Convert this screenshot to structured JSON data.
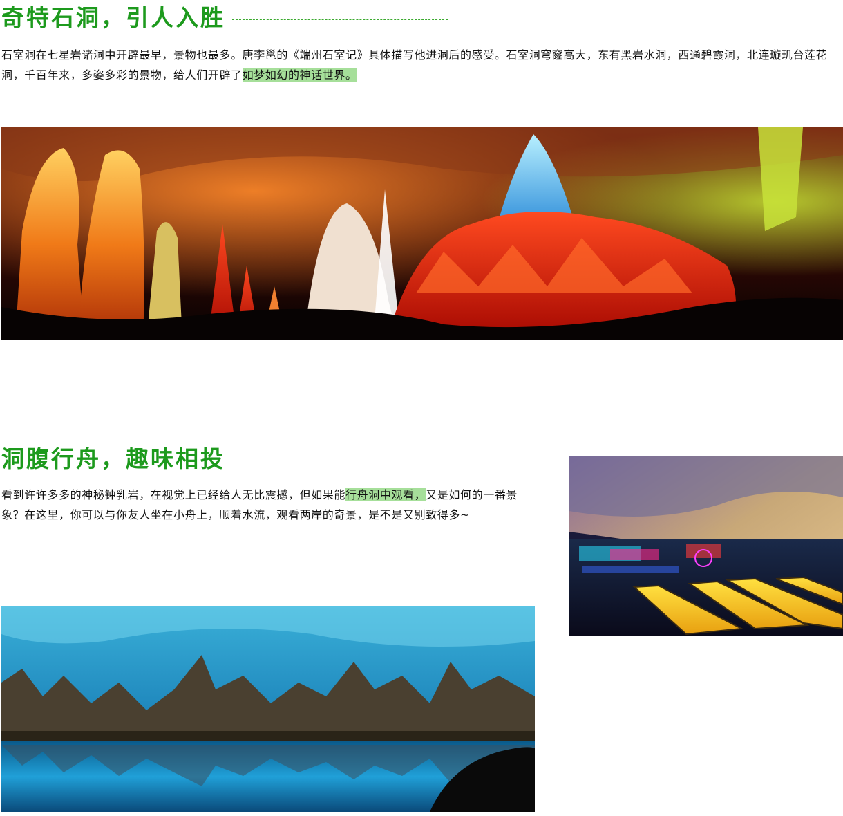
{
  "accent_color": "#1d9a1d",
  "highlight_color": "#a6df9a",
  "section1": {
    "title": "奇特石洞，引人入胜",
    "text_before": "石室洞在七星岩诸洞中开辟最早，景物也最多。唐李邕的《端州石室记》具体描写他进洞后的感受。石室洞穹窿高大，东有黑岩水洞，西通碧霞洞，北连璇玑台莲花洞，千百年来，多姿多彩的景物，给人们开辟了",
    "highlight": "如梦如幻的神话世界。",
    "image": "cave-panorama-photo"
  },
  "section2": {
    "title": "洞腹行舟，趣味相投",
    "text_before": "看到许许多多的神秘钟乳岩，在视觉上已经给人无比震撼，但如果能",
    "highlight": "行舟洞中观看，",
    "text_after": "又是如何的一番景象？在这里，你可以与你友人坐在小舟上，顺着水流，观看两岸的奇景，是不是又别致得多~",
    "image_boats": "cave-boats-photo",
    "image_lake": "blue-cave-lake-photo"
  }
}
